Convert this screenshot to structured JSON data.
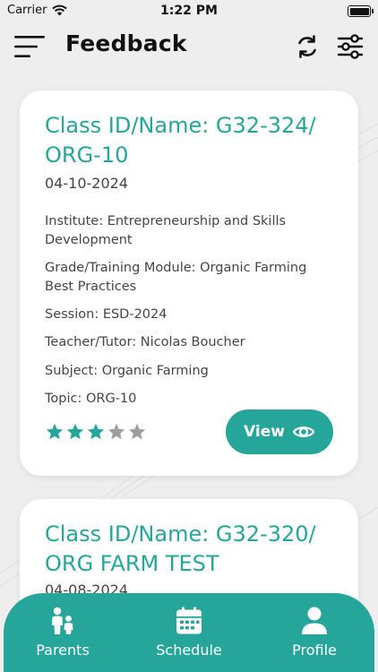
{
  "status_bar": {
    "carrier": "Carrier",
    "time": "1:22 PM"
  },
  "header": {
    "title": "Feedback"
  },
  "cards": [
    {
      "title": "Class ID/Name: G32-324/ ORG-10",
      "date": "04-10-2024",
      "institute": "Institute: Entrepreneurship and Skills Development",
      "grade": "Grade/Training Module: Organic Farming Best Practices",
      "session": "Session: ESD-2024",
      "teacher": "Teacher/Tutor: Nicolas Boucher",
      "subject": "Subject: Organic Farming",
      "topic": "Topic: ORG-10",
      "rating": 3,
      "rating_max": 5,
      "view_label": "View"
    },
    {
      "title": "Class ID/Name: G32-320/ ORG FARM TEST",
      "date": "04-08-2024"
    }
  ],
  "bottom_nav": {
    "items": [
      {
        "label": "Parents",
        "icon": "family-icon"
      },
      {
        "label": "Schedule",
        "icon": "calendar-icon"
      },
      {
        "label": "Profile",
        "icon": "person-icon"
      }
    ]
  },
  "colors": {
    "accent": "#26a69a",
    "star_filled": "#26a69a",
    "star_empty": "#9e9e9e",
    "background": "#eeeeee"
  }
}
